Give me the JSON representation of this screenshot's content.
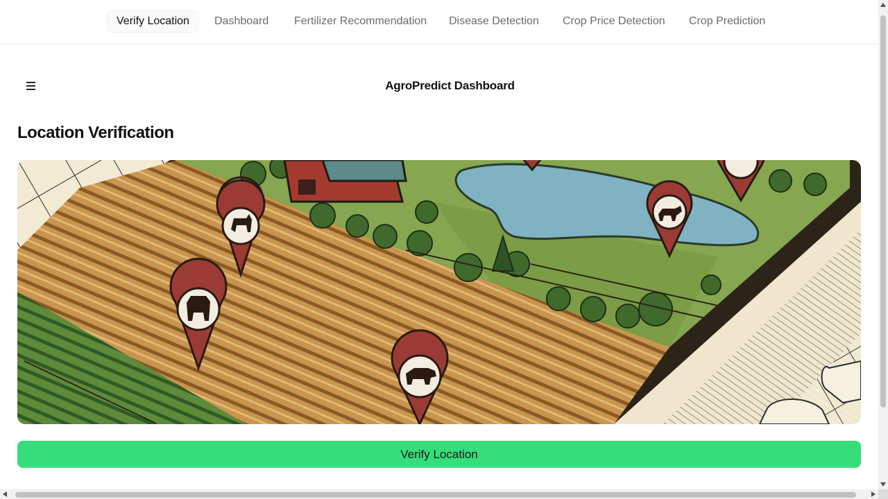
{
  "nav": {
    "tabs": [
      {
        "label": "Verify Location",
        "active": true
      },
      {
        "label": "Dashboard",
        "active": false
      },
      {
        "label": "Fertilizer Recommendation",
        "active": false
      },
      {
        "label": "Disease Detection",
        "active": false
      },
      {
        "label": "Crop Price Detection",
        "active": false
      },
      {
        "label": "Crop Prediction",
        "active": false
      }
    ]
  },
  "header": {
    "menu_icon": "hamburger-menu-icon",
    "title": "AgroPredict Dashboard"
  },
  "main": {
    "section_title": "Location Verification",
    "hero_image": "farm-map-illustration",
    "verify_button_label": "Verify Location"
  },
  "colors": {
    "accent": "#35de7b",
    "active_tab_text": "#111111",
    "inactive_tab_text": "#6b6b6b"
  }
}
